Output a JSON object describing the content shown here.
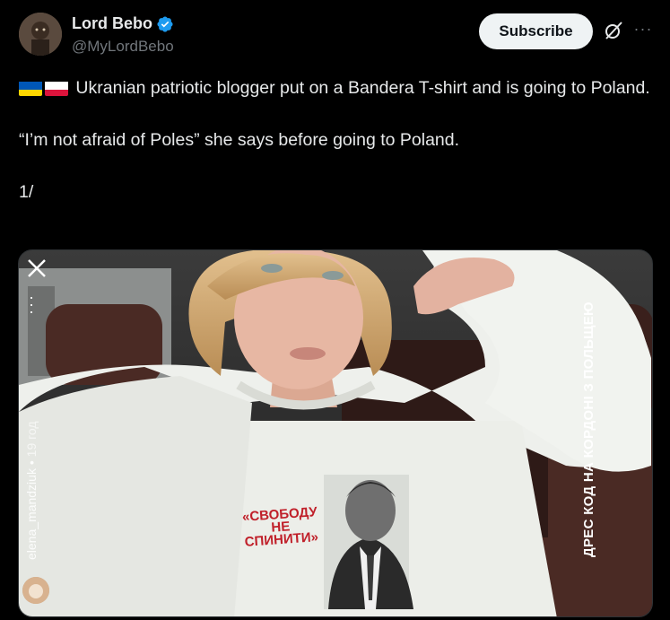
{
  "author": {
    "display_name": "Lord Bebo",
    "handle": "@MyLordBebo",
    "verified": true
  },
  "actions": {
    "subscribe_label": "Subscribe",
    "grok_icon": "grok-icon",
    "more_icon": "more-options-icon",
    "more_label": "···"
  },
  "tweet": {
    "flags": [
      "ukraine-flag",
      "poland-flag"
    ],
    "line1": "Ukranian patriotic blogger put on a Bandera T-shirt and is going to Poland.",
    "line2": "“I’m not afraid of Poles” she says before going to Poland.",
    "line3": "1/"
  },
  "media": {
    "story_user": "elena_mandziuk",
    "story_time": "19 год",
    "overlay_caption": "ДРЕС КОД НА КОРДОНІ З ПОЛЬЩЕЮ",
    "shirt_slogan_line1": "«СВОБОДУ",
    "shirt_slogan_line2": "НЕ",
    "shirt_slogan_line3": "СПИНИТИ»"
  },
  "colors": {
    "background": "#000000",
    "text": "#e7e9ea",
    "secondary": "#71767b",
    "verified": "#1d9bf0",
    "subscribe_bg": "#eff3f4"
  }
}
